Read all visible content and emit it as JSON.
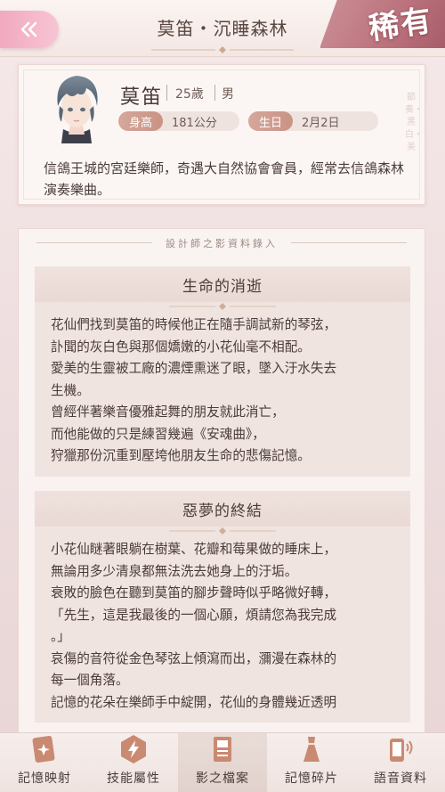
{
  "header": {
    "title": "莫笛・沉睡森林",
    "rarity": "稀有"
  },
  "profile": {
    "name": "莫笛",
    "age": "25歲",
    "gender": "男",
    "height_label": "身高",
    "height_value": "181公分",
    "birthday_label": "生日",
    "birthday_value": "2月2日",
    "description": "信鴿王城的宮廷樂師，奇遇大自然協會會員，經常去信鴿森林演奏樂曲。",
    "side_text": "節奏・黑白・美"
  },
  "records": {
    "heading": "設計師之影資料錄入",
    "sections": [
      {
        "title": "生命的消逝",
        "lines": [
          "花仙們找到莫笛的時候他正在隨手調試新的琴弦，",
          "訃聞的灰白色與那個嬌嫩的小花仙毫不相配。",
          "愛美的生靈被工廠的濃煙熏迷了眼，墜入汙水失去",
          "生機。",
          "曾經伴著樂音優雅起舞的朋友就此消亡，",
          "而他能做的只是練習幾遍《安魂曲》，",
          "狩獵那份沉重到壓垮他朋友生命的悲傷記憶。"
        ]
      },
      {
        "title": "惡夢的終結",
        "lines": [
          "小花仙瞇著眼躺在樹葉、花瓣和莓果做的睡床上，",
          "無論用多少清泉都無法洗去她身上的汙垢。",
          "衰敗的臉色在聽到莫笛的腳步聲時似乎略微好轉，",
          "「先生，這是我最後的一個心願，煩請您為我完成",
          "。」",
          "哀傷的音符從金色琴弦上傾瀉而出，瀰漫在森林的",
          "每一個角落。",
          "記憶的花朵在樂師手中綻開，花仙的身體幾近透明"
        ]
      }
    ]
  },
  "nav": {
    "items": [
      {
        "label": "記憶映射",
        "icon": "memory-card-icon"
      },
      {
        "label": "技能屬性",
        "icon": "lightning-icon"
      },
      {
        "label": "影之檔案",
        "icon": "document-icon"
      },
      {
        "label": "記憶碎片",
        "icon": "dress-icon"
      },
      {
        "label": "語音資料",
        "icon": "phone-voice-icon"
      }
    ],
    "active_index": 2
  },
  "colors": {
    "accent_pink": "#f1a9c0",
    "rarity_band": "#b86e79",
    "stat_label": "#c99385"
  }
}
